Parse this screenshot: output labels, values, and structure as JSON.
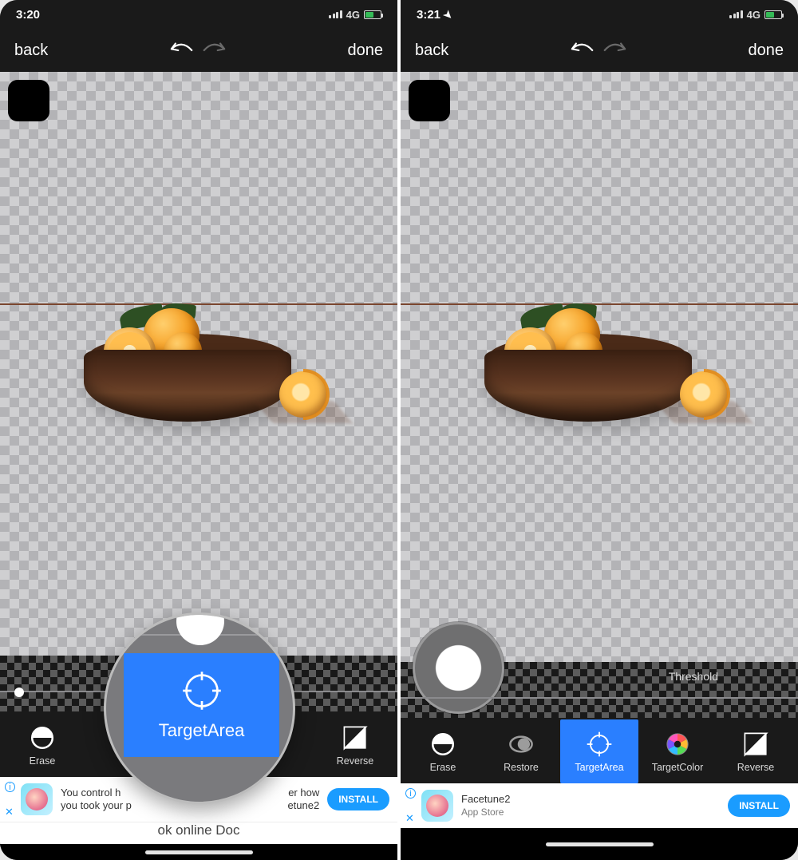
{
  "screens": [
    {
      "status": {
        "time": "3:20",
        "network": "4G",
        "location_visible": false
      },
      "nav": {
        "back": "back",
        "done": "done"
      },
      "brush_bar": {
        "show_threshold_label": false,
        "threshold_label": "Threshold",
        "show_circle": false
      },
      "tools": {
        "items": [
          {
            "key": "erase",
            "label": "Erase",
            "active": false
          },
          {
            "key": "restore",
            "label": "Re",
            "active": false
          },
          {
            "key": "targetarea",
            "label": "TargetArea",
            "active": true
          },
          {
            "key": "targetcolor",
            "label": "olor",
            "active": false
          },
          {
            "key": "reverse",
            "label": "Reverse",
            "active": false
          }
        ]
      },
      "magnifier": {
        "visible": true,
        "label": "TargetArea",
        "subtext": "ok online Doc"
      },
      "ad": {
        "line1": "You control h",
        "line2": "you took your p",
        "line1_tail": "er how",
        "line2_tail": "etune2",
        "install": "INSTALL"
      }
    },
    {
      "status": {
        "time": "3:21",
        "network": "4G",
        "location_visible": true
      },
      "nav": {
        "back": "back",
        "done": "done"
      },
      "brush_bar": {
        "show_threshold_label": true,
        "threshold_label": "Threshold",
        "show_circle": true
      },
      "tools": {
        "items": [
          {
            "key": "erase",
            "label": "Erase",
            "active": false
          },
          {
            "key": "restore",
            "label": "Restore",
            "active": false
          },
          {
            "key": "targetarea",
            "label": "TargetArea",
            "active": true
          },
          {
            "key": "targetcolor",
            "label": "TargetColor",
            "active": false
          },
          {
            "key": "reverse",
            "label": "Reverse",
            "active": false
          }
        ]
      },
      "magnifier": {
        "visible": false
      },
      "ad": {
        "title": "Facetune2",
        "subtitle": "App Store",
        "install": "INSTALL"
      }
    }
  ],
  "tool_icons": {
    "erase": "erase-icon",
    "restore": "restore-icon",
    "targetarea": "target-icon",
    "targetcolor": "colorwheel-icon",
    "reverse": "reverse-icon"
  }
}
